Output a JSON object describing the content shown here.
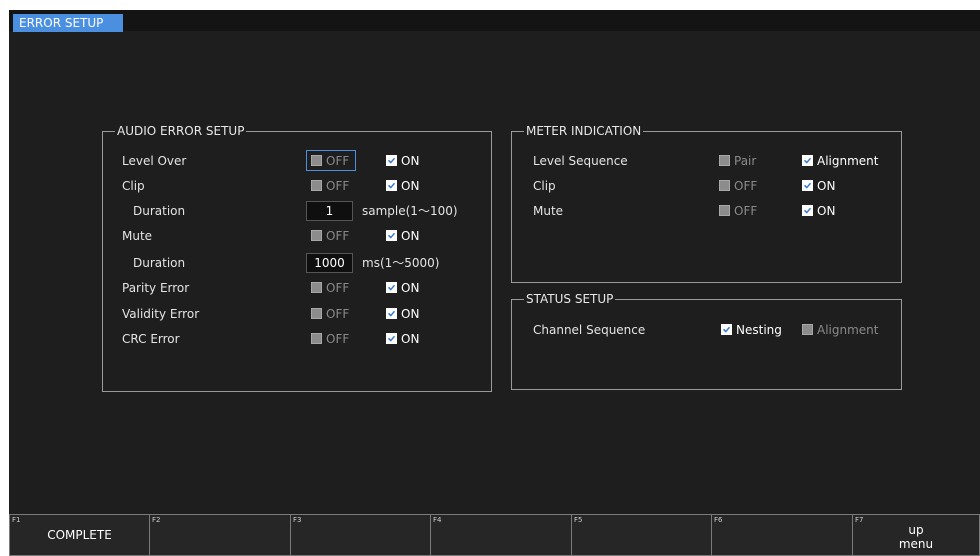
{
  "header": {
    "tab_label": "ERROR SETUP"
  },
  "audio_error": {
    "title": "AUDIO ERROR SETUP",
    "rows": {
      "level_over": {
        "label": "Level Over",
        "off": "OFF",
        "on": "ON"
      },
      "clip": {
        "label": "Clip",
        "off": "OFF",
        "on": "ON"
      },
      "clip_duration": {
        "label": "Duration",
        "value": "1",
        "unit": "sample(1〜100)"
      },
      "mute": {
        "label": "Mute",
        "off": "OFF",
        "on": "ON"
      },
      "mute_duration": {
        "label": "Duration",
        "value": "1000",
        "unit": "ms(1〜5000)"
      },
      "parity": {
        "label": "Parity Error",
        "off": "OFF",
        "on": "ON"
      },
      "validity": {
        "label": "Validity Error",
        "off": "OFF",
        "on": "ON"
      },
      "crc": {
        "label": "CRC Error",
        "off": "OFF",
        "on": "ON"
      }
    }
  },
  "meter": {
    "title": "METER INDICATION",
    "rows": {
      "level_sequence": {
        "label": "Level Sequence",
        "opt1": "Pair",
        "opt2": "Alignment"
      },
      "clip": {
        "label": "Clip",
        "opt1": "OFF",
        "opt2": "ON"
      },
      "mute": {
        "label": "Mute",
        "opt1": "OFF",
        "opt2": "ON"
      }
    }
  },
  "status": {
    "title": "STATUS SETUP",
    "channel_sequence": {
      "label": "Channel Sequence",
      "opt1": "Nesting",
      "opt2": "Alignment"
    }
  },
  "fkeys": [
    {
      "num": "F1",
      "label": "COMPLETE"
    },
    {
      "num": "F2",
      "label": ""
    },
    {
      "num": "F3",
      "label": ""
    },
    {
      "num": "F4",
      "label": ""
    },
    {
      "num": "F5",
      "label": ""
    },
    {
      "num": "F6",
      "label": ""
    },
    {
      "num": "F7",
      "label": "up\nmenu"
    }
  ],
  "colors": {
    "accent": "#4a8fe0",
    "background": "#1e1e1e",
    "checkbox_check": "#3578d0"
  }
}
